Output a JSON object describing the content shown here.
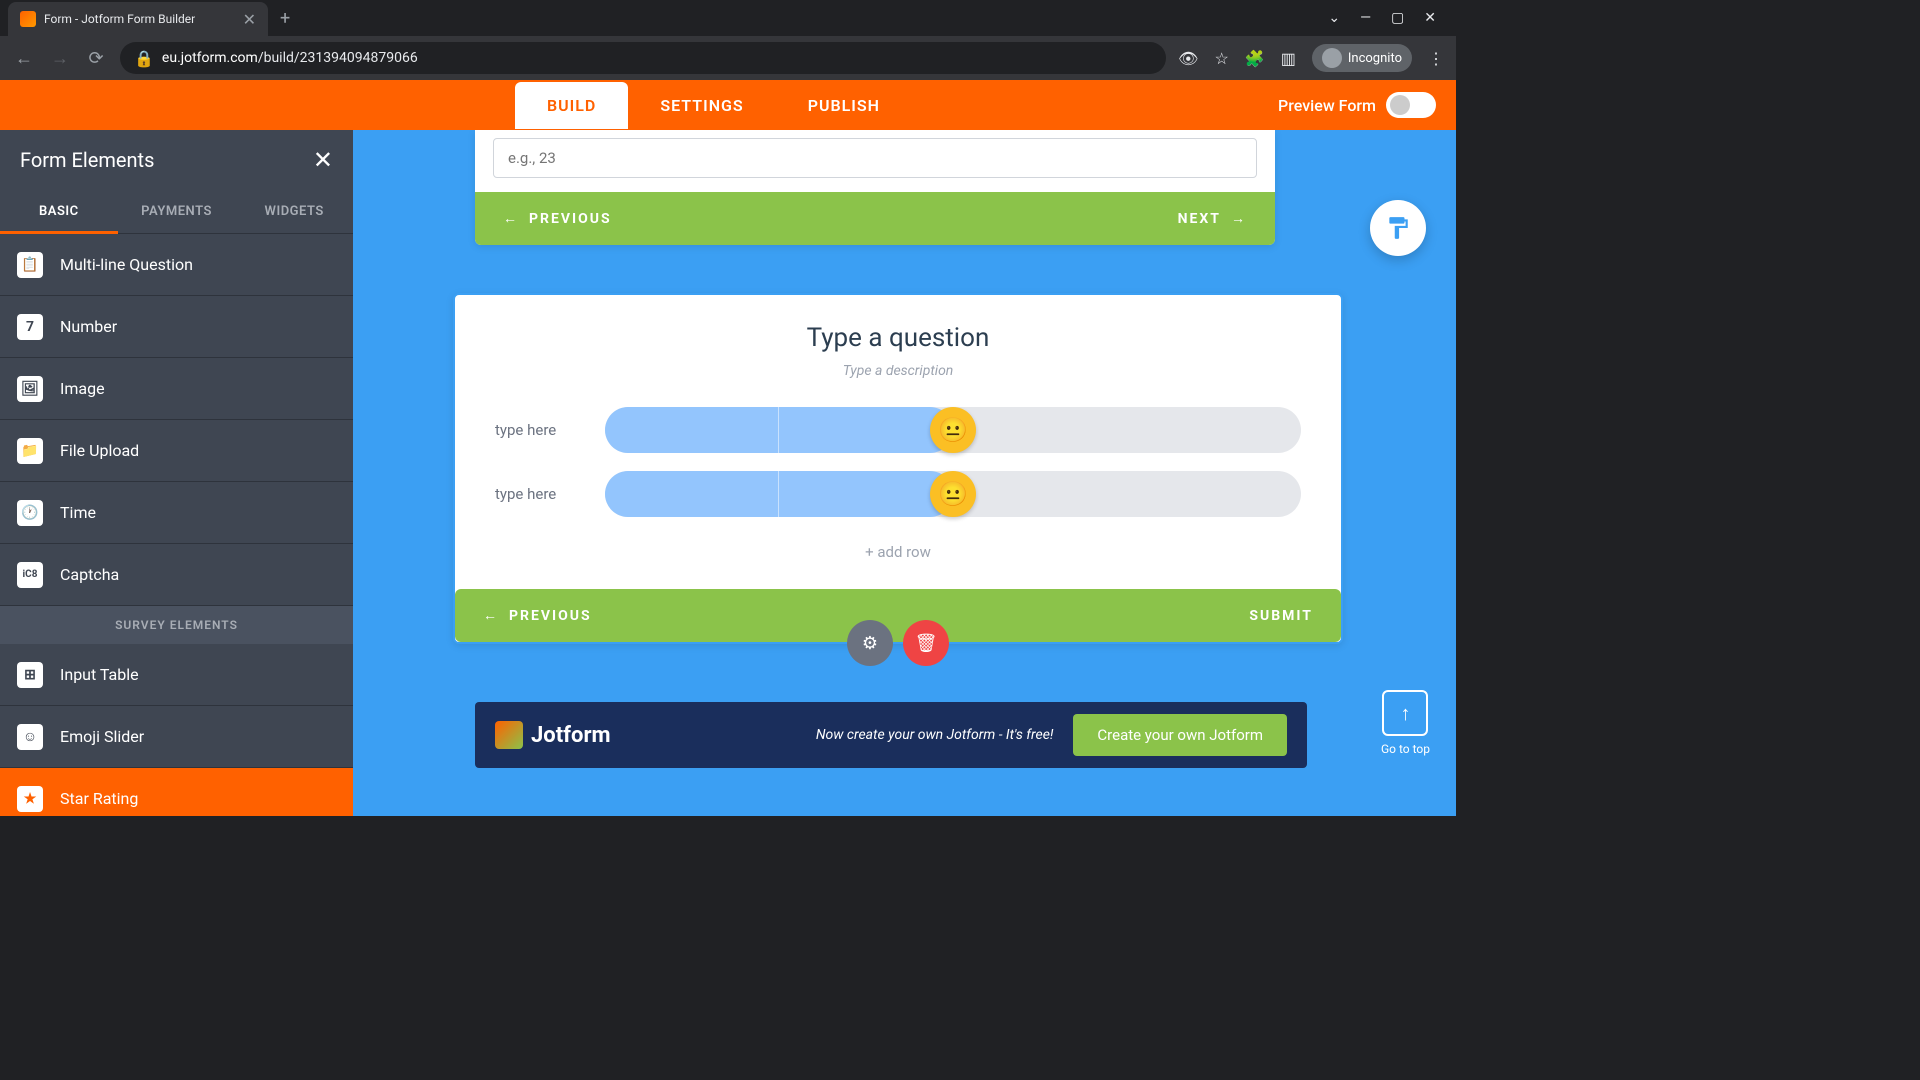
{
  "browser": {
    "tab_title": "Form - Jotform Form Builder",
    "url_domain": "eu.jotform.com",
    "url_path": "/build/231394094879066",
    "incognito_label": "Incognito"
  },
  "header": {
    "tabs": {
      "build": "BUILD",
      "settings": "SETTINGS",
      "publish": "PUBLISH"
    },
    "preview_label": "Preview Form"
  },
  "sidebar": {
    "title": "Form Elements",
    "tabs": {
      "basic": "BASIC",
      "payments": "PAYMENTS",
      "widgets": "WIDGETS"
    },
    "items": {
      "multiline": "Multi-line Question",
      "number": "Number",
      "image": "Image",
      "fileupload": "File Upload",
      "time": "Time",
      "captcha": "Captcha"
    },
    "section_survey": "SURVEY ELEMENTS",
    "survey_items": {
      "inputtable": "Input Table",
      "emojislider": "Emoji Slider",
      "starrating": "Star Rating"
    }
  },
  "canvas": {
    "top_input_placeholder": "e.g., 23",
    "prev_label": "PREVIOUS",
    "next_label": "NEXT",
    "submit_label": "SUBMIT",
    "question_title": "Type a question",
    "question_desc": "Type a description",
    "row_placeholder": "type here",
    "add_row": "+ add row",
    "goto_top": "Go to top"
  },
  "promo": {
    "brand": "Jotform",
    "text": "Now create your own Jotform - It's free!",
    "cta": "Create your own Jotform"
  }
}
